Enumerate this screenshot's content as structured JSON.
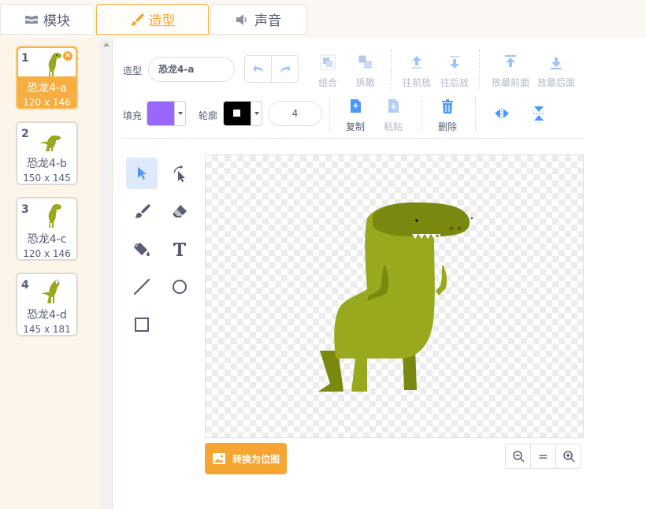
{
  "tabs": [
    {
      "label": "模块",
      "icon": "code-blocks-icon",
      "active": false
    },
    {
      "label": "造型",
      "icon": "paintbrush-icon",
      "active": true
    },
    {
      "label": "声音",
      "icon": "speaker-icon",
      "active": false
    }
  ],
  "costumes": [
    {
      "number": "1",
      "name": "恐龙4-a",
      "size": "120 x 146",
      "selected": true
    },
    {
      "number": "2",
      "name": "恐龙4-b",
      "size": "150 x 145",
      "selected": false
    },
    {
      "number": "3",
      "name": "恐龙4-c",
      "size": "120 x 146",
      "selected": false
    },
    {
      "number": "4",
      "name": "恐龙4-d",
      "size": "145 x 181",
      "selected": false
    }
  ],
  "toolbar": {
    "costume_label": "造型",
    "costume_name": "恐龙4-a",
    "group_label": "组合",
    "ungroup_label": "拆散",
    "forward_label": "往前放",
    "backward_label": "往后放",
    "front_label": "放最前面",
    "back_label": "放最后面",
    "fill_label": "填充",
    "outline_label": "轮廓",
    "outline_width": "4",
    "copy_label": "复制",
    "paste_label": "粘贴",
    "delete_label": "删除"
  },
  "colors": {
    "accent": "#f7a531",
    "fill": "#9966ff",
    "outline": "#000000",
    "dino": "#9aa81e",
    "dino_dark": "#7a8810"
  },
  "convert_label": "转换为位图",
  "zoom": {
    "out": "zoom-out-icon",
    "reset": "=",
    "in": "zoom-in-icon"
  }
}
